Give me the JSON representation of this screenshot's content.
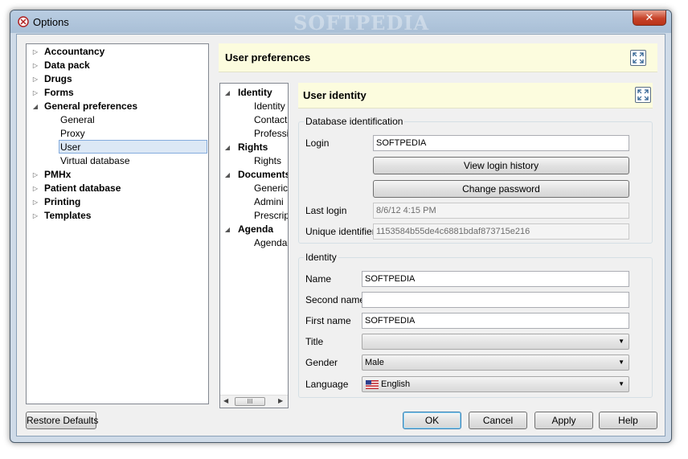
{
  "window": {
    "title": "Options",
    "watermark": "SOFTPEDIA",
    "close_glyph": "✕"
  },
  "nav_tree": {
    "items": [
      {
        "label": "Accountancy",
        "level": 0,
        "bold": true,
        "expanded": false
      },
      {
        "label": "Data pack",
        "level": 0,
        "bold": true,
        "expanded": false
      },
      {
        "label": "Drugs",
        "level": 0,
        "bold": true,
        "expanded": false
      },
      {
        "label": "Forms",
        "level": 0,
        "bold": true,
        "expanded": false
      },
      {
        "label": "General preferences",
        "level": 0,
        "bold": true,
        "expanded": true
      },
      {
        "label": "General",
        "level": 1,
        "bold": false
      },
      {
        "label": "Proxy",
        "level": 1,
        "bold": false
      },
      {
        "label": "User",
        "level": 1,
        "bold": false,
        "selected": true
      },
      {
        "label": "Virtual database",
        "level": 1,
        "bold": false
      },
      {
        "label": "PMHx",
        "level": 0,
        "bold": true,
        "expanded": false
      },
      {
        "label": "Patient database",
        "level": 0,
        "bold": true,
        "expanded": false
      },
      {
        "label": "Printing",
        "level": 0,
        "bold": true,
        "expanded": false
      },
      {
        "label": "Templates",
        "level": 0,
        "bold": true,
        "expanded": false
      }
    ]
  },
  "prefs": {
    "title": "User preferences"
  },
  "subtree": {
    "items": [
      {
        "label": "Identity",
        "level": 0,
        "bold": true
      },
      {
        "label": "Identity",
        "level": 1,
        "bold": false
      },
      {
        "label": "Contact",
        "level": 1,
        "bold": false
      },
      {
        "label": "Professi",
        "level": 1,
        "bold": false
      },
      {
        "label": "Rights",
        "level": 0,
        "bold": true
      },
      {
        "label": "Rights",
        "level": 1,
        "bold": false
      },
      {
        "label": "Documents",
        "level": 0,
        "bold": true
      },
      {
        "label": "Generic",
        "level": 1,
        "bold": false
      },
      {
        "label": "Admini",
        "level": 1,
        "bold": false
      },
      {
        "label": "Prescrip",
        "level": 1,
        "bold": false
      },
      {
        "label": "Agenda",
        "level": 0,
        "bold": true
      },
      {
        "label": "Agenda",
        "level": 1,
        "bold": false
      }
    ],
    "scroll_thumb": "III"
  },
  "identity_panel": {
    "title": "User identity",
    "db_group": {
      "title": "Database identification",
      "login_label": "Login",
      "login_value": "SOFTPEDIA",
      "view_history_button": "View login history",
      "change_password_button": "Change password",
      "last_login_label": "Last login",
      "last_login_value": "8/6/12 4:15 PM",
      "uid_label": "Unique identifier",
      "uid_value": "1153584b55de4c6881bdaf873715e216"
    },
    "identity_group": {
      "title": "Identity",
      "name_label": "Name",
      "name_value": "SOFTPEDIA",
      "second_name_label": "Second name",
      "second_name_value": "",
      "first_name_label": "First name",
      "first_name_value": "SOFTPEDIA",
      "title_label": "Title",
      "title_value": "",
      "gender_label": "Gender",
      "gender_value": "Male",
      "language_label": "Language",
      "language_value": "English",
      "language_flag": "us-flag-icon"
    }
  },
  "footer": {
    "restore_defaults": "Restore Defaults",
    "ok": "OK",
    "cancel": "Cancel",
    "apply": "Apply",
    "help": "Help"
  },
  "colors": {
    "header_bg": "#fcfcde",
    "selection_bg": "#dce8f5",
    "close_button": "#c7432a"
  }
}
